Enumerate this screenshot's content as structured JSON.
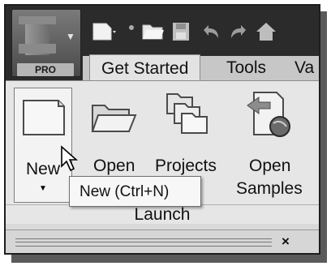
{
  "app": {
    "badge": "PRO",
    "logo_icon": "app-logo-icon"
  },
  "quick_access": [
    "new-doc-icon",
    "open-folder-icon",
    "save-icon",
    "undo-icon",
    "redo-icon",
    "home-icon"
  ],
  "tabs": [
    {
      "label": "Get Started",
      "active": true
    },
    {
      "label": "Tools",
      "active": false
    },
    {
      "label": "Va",
      "active": false
    }
  ],
  "panel": {
    "title": "Launch",
    "commands": [
      {
        "label": "New",
        "icon": "new-document-icon"
      },
      {
        "label": "Open",
        "icon": "open-folder-icon"
      },
      {
        "label": "Projects",
        "icon": "projects-icon"
      },
      {
        "label_line1": "Open",
        "label_line2": "Samples",
        "icon": "samples-icon"
      }
    ]
  },
  "tooltip": "New (Ctrl+N)",
  "bottom": {
    "close_label": "×"
  }
}
